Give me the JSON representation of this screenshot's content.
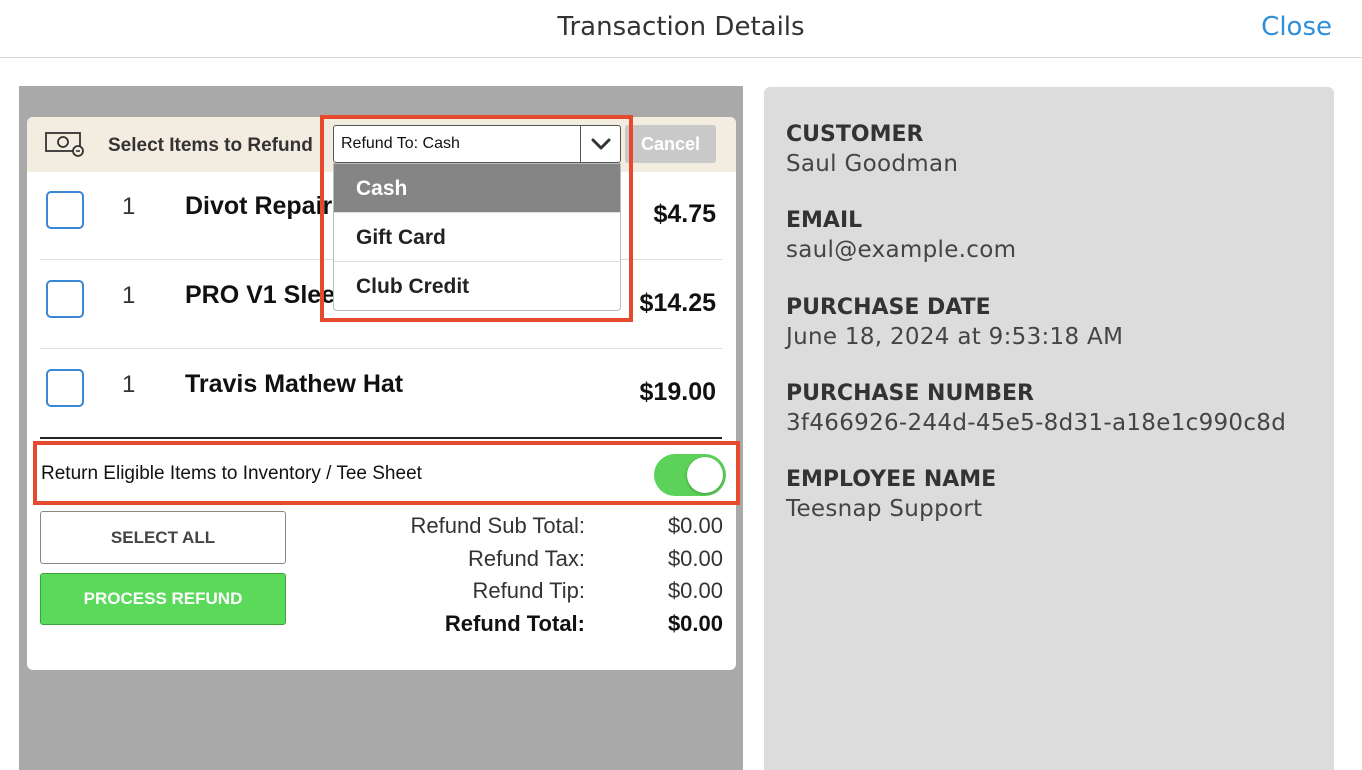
{
  "header": {
    "title": "Transaction Details",
    "close_label": "Close"
  },
  "refund_card": {
    "header_label": "Select Items to Refund",
    "refund_to_value": "Refund To: Cash",
    "cancel_label": "Cancel",
    "icons": {
      "money": "cash-icon",
      "chevron": "chevron-down-icon"
    },
    "items": [
      {
        "qty": "1",
        "name": "Divot Repair",
        "price": "$4.75",
        "checked": false
      },
      {
        "qty": "1",
        "name": "PRO V1 Slee",
        "price": "$14.25",
        "checked": false
      },
      {
        "qty": "1",
        "name": "Travis Mathew Hat",
        "price": "$19.00",
        "checked": false
      }
    ],
    "return_inventory_label": "Return Eligible Items to Inventory / Tee Sheet",
    "return_inventory_on": true,
    "select_all_label": "SELECT ALL",
    "process_refund_label": "PROCESS REFUND",
    "totals": [
      {
        "label": "Refund Sub Total:",
        "value": "$0.00"
      },
      {
        "label": "Refund Tax:",
        "value": "$0.00"
      },
      {
        "label": "Refund Tip:",
        "value": "$0.00"
      },
      {
        "label": "Refund Total:",
        "value": "$0.00"
      }
    ]
  },
  "refund_dropdown": {
    "options": [
      "Cash",
      "Gift Card",
      "Club Credit"
    ],
    "selected": "Cash"
  },
  "customer_info": [
    {
      "label": "CUSTOMER",
      "value": "Saul Goodman"
    },
    {
      "label": "EMAIL",
      "value": "saul@example.com"
    },
    {
      "label": "PURCHASE DATE",
      "value": "June 18, 2024 at 9:53:18 AM"
    },
    {
      "label": "PURCHASE NUMBER",
      "value": "3f466926-244d-45e5-8d31-a18e1c990c8d"
    },
    {
      "label": "EMPLOYEE NAME",
      "value": "Teesnap Support"
    }
  ],
  "colors": {
    "accent_blue": "#2f8fd9",
    "toggle_on": "#5dd25a",
    "process_green": "#5bd95b",
    "highlight_red": "#e64a2e"
  }
}
